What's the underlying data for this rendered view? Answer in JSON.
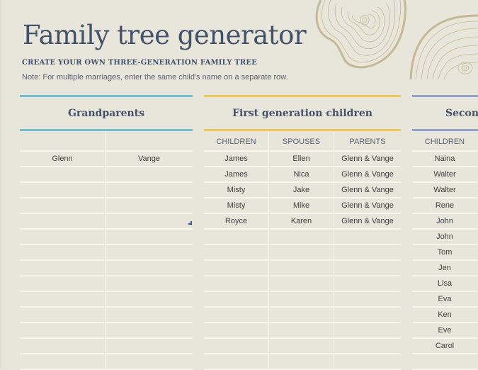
{
  "header": {
    "title": "Family tree generator",
    "subtitle": "CREATE YOUR OWN THREE-GENERATION FAMILY TREE",
    "note": "Note: For multiple marriages, enter the same child's name on a separate row."
  },
  "colors": {
    "grandparents_accent": "#6fc0d2",
    "first_gen_accent": "#edc95a",
    "second_gen_accent": "#8fa3c9",
    "title_color": "#42526b",
    "background": "#e8e5da"
  },
  "sections": {
    "grandparents": {
      "title": "Grandparents",
      "columns": [
        "",
        ""
      ],
      "rows": [
        [
          "Glenn",
          "Vange"
        ],
        [
          "",
          ""
        ],
        [
          "",
          ""
        ],
        [
          "",
          ""
        ],
        [
          "",
          ""
        ],
        [
          "",
          ""
        ],
        [
          "",
          ""
        ],
        [
          "",
          ""
        ],
        [
          "",
          ""
        ],
        [
          "",
          ""
        ],
        [
          "",
          ""
        ],
        [
          "",
          ""
        ],
        [
          "",
          ""
        ],
        [
          "",
          ""
        ]
      ]
    },
    "first_generation": {
      "title": "First generation children",
      "columns": [
        "CHILDREN",
        "SPOUSES",
        "PARENTS"
      ],
      "rows": [
        [
          "James",
          "Ellen",
          "Glenn & Vange"
        ],
        [
          "James",
          "Nica",
          "Glenn & Vange"
        ],
        [
          "Misty",
          "Jake",
          "Glenn & Vange"
        ],
        [
          "Misty",
          "Mike",
          "Glenn & Vange"
        ],
        [
          "Royce",
          "Karen",
          "Glenn & Vange"
        ],
        [
          "",
          "",
          ""
        ],
        [
          "",
          "",
          ""
        ],
        [
          "",
          "",
          ""
        ],
        [
          "",
          "",
          ""
        ],
        [
          "",
          "",
          ""
        ],
        [
          "",
          "",
          ""
        ],
        [
          "",
          "",
          ""
        ],
        [
          "",
          "",
          ""
        ],
        [
          "",
          "",
          ""
        ]
      ]
    },
    "second_generation": {
      "title": "Second generation children",
      "columns": [
        "CHILDREN"
      ],
      "rows": [
        [
          "Naina"
        ],
        [
          "Walter"
        ],
        [
          "Walter"
        ],
        [
          "Rene"
        ],
        [
          "John"
        ],
        [
          "John"
        ],
        [
          "Tom"
        ],
        [
          "Jen"
        ],
        [
          "Lisa"
        ],
        [
          "Eva"
        ],
        [
          "Ken"
        ],
        [
          "Eve"
        ],
        [
          "Carol"
        ],
        [
          ""
        ]
      ]
    }
  }
}
